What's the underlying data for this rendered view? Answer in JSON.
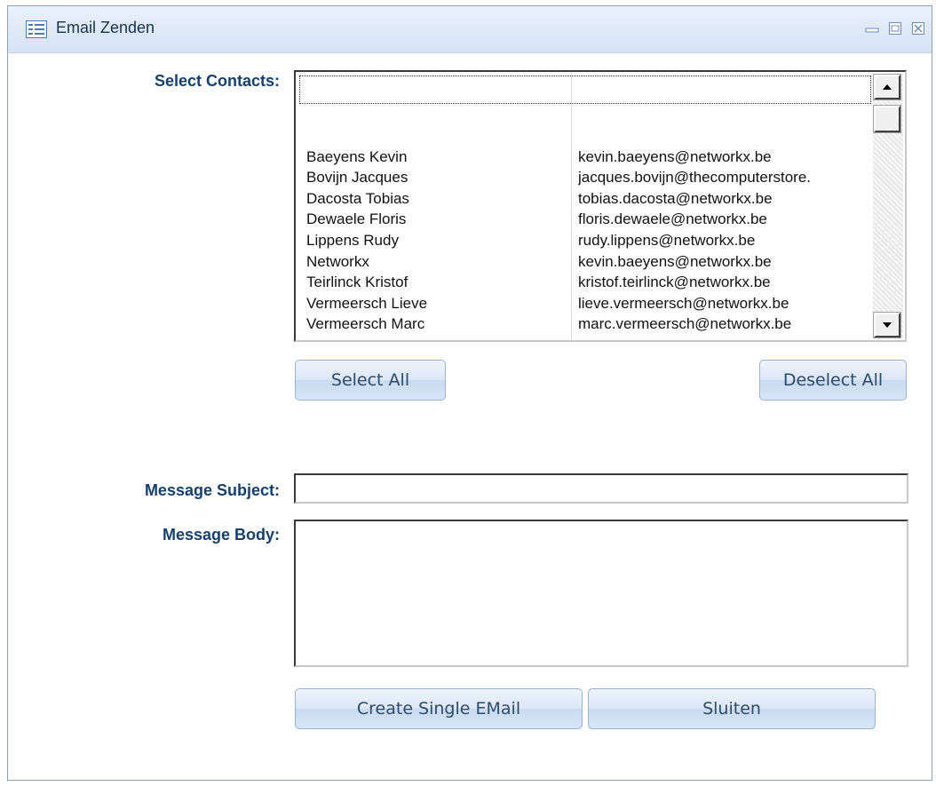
{
  "window": {
    "title": "Email Zenden",
    "icons": {
      "form": "form-icon",
      "minimize": "minimize-icon",
      "restore": "restore-icon",
      "close": "close-icon"
    }
  },
  "labels": {
    "contacts": "Select Contacts:",
    "subject": "Message Subject:",
    "body": "Message Body:"
  },
  "contacts": {
    "header": [
      "",
      ""
    ],
    "rows": [
      {
        "name": "",
        "email": ""
      },
      {
        "name": "Baeyens Kevin",
        "email": "kevin.baeyens@networkx.be"
      },
      {
        "name": "Bovijn Jacques",
        "email": "jacques.bovijn@thecomputerstore."
      },
      {
        "name": "Dacosta Tobias",
        "email": "tobias.dacosta@networkx.be"
      },
      {
        "name": "Dewaele Floris",
        "email": "floris.dewaele@networkx.be"
      },
      {
        "name": "Lippens Rudy",
        "email": "rudy.lippens@networkx.be"
      },
      {
        "name": "Networkx",
        "email": "kevin.baeyens@networkx.be"
      },
      {
        "name": "Teirlinck Kristof",
        "email": "kristof.teirlinck@networkx.be"
      },
      {
        "name": "Vermeersch Lieve",
        "email": "lieve.vermeersch@networkx.be"
      },
      {
        "name": "Vermeersch Marc",
        "email": "marc.vermeersch@networkx.be"
      }
    ]
  },
  "buttons": {
    "select_all": "Select All",
    "deselect_all": "Deselect All",
    "create_email": "Create Single EMail",
    "close": "Sluiten"
  },
  "inputs": {
    "subject_value": "",
    "body_value": ""
  },
  "colors": {
    "label": "#15406a",
    "button_text": "#2e4a6a",
    "titlebar": "#dce7f5"
  }
}
